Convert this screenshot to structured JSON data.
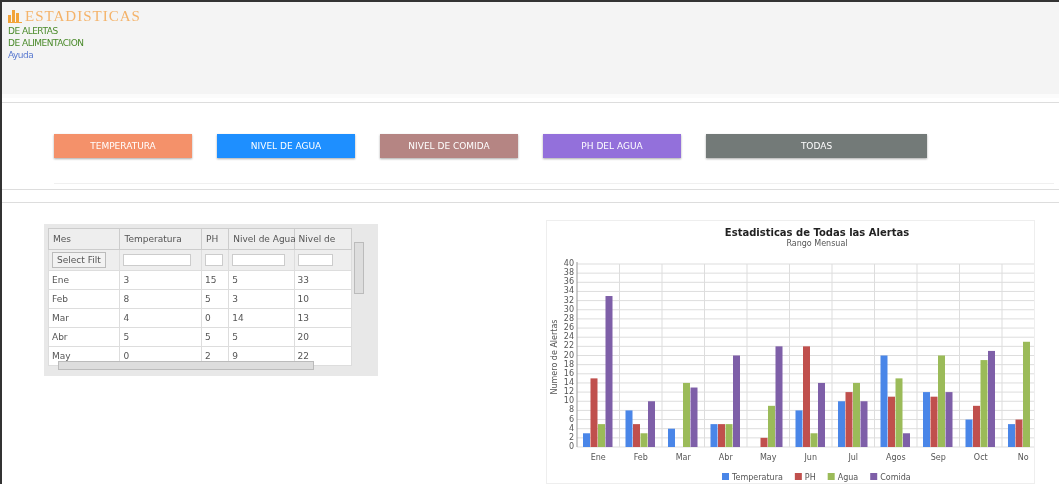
{
  "header": {
    "title": "ESTADISTICAS",
    "links": [
      {
        "label": "DE ALERTAS",
        "kind": "nav"
      },
      {
        "label": "DE ALIMENTACION",
        "kind": "nav"
      },
      {
        "label": "Ayuda",
        "kind": "help"
      }
    ]
  },
  "filters": [
    {
      "label": "TEMPERATURA",
      "color": "#f4916a"
    },
    {
      "label": "NIVEL DE AGUA",
      "color": "#1e8fff"
    },
    {
      "label": "NIVEL DE COMIDA",
      "color": "#b58583"
    },
    {
      "label": "PH DEL AGUA",
      "color": "#9370db"
    },
    {
      "label": "TODAS",
      "color": "#737a78"
    }
  ],
  "table": {
    "columns": [
      "Mes",
      "Temperatura",
      "PH",
      "Nivel de Agua",
      "Nivel de"
    ],
    "filter_button": "Select Filt",
    "rows": [
      [
        "Ene",
        "3",
        "15",
        "5",
        "33"
      ],
      [
        "Feb",
        "8",
        "5",
        "3",
        "10"
      ],
      [
        "Mar",
        "4",
        "0",
        "14",
        "13"
      ],
      [
        "Abr",
        "5",
        "5",
        "5",
        "20"
      ],
      [
        "May",
        "0",
        "2",
        "9",
        "22"
      ]
    ]
  },
  "chart": {
    "chart_data": {
      "type": "bar",
      "title": "Estadisticas de Todas las Alertas",
      "subtitle": "Rango Mensual",
      "ylabel": "Numero de Alertas",
      "categories": [
        "Ene",
        "Feb",
        "Mar",
        "Abr",
        "May",
        "Jun",
        "Jul",
        "Agos",
        "Sep",
        "Oct",
        "No"
      ],
      "grid": true,
      "legend": true,
      "ylim": [
        0,
        40
      ],
      "yticks": [
        0,
        2,
        4,
        6,
        8,
        10,
        12,
        14,
        16,
        18,
        20,
        22,
        24,
        26,
        28,
        30,
        32,
        34,
        36,
        38,
        40
      ],
      "series": [
        {
          "name": "Temperatura",
          "color": "#4a86e8",
          "values": [
            3,
            8,
            4,
            5,
            0,
            8,
            10,
            20,
            12,
            6,
            5
          ]
        },
        {
          "name": "PH",
          "color": "#c0504d",
          "values": [
            15,
            5,
            0,
            5,
            2,
            22,
            12,
            11,
            11,
            9,
            6
          ]
        },
        {
          "name": "Agua",
          "color": "#9bbb59",
          "values": [
            5,
            3,
            14,
            5,
            9,
            3,
            14,
            15,
            20,
            19,
            23
          ]
        },
        {
          "name": "Comida",
          "color": "#7e5fa8",
          "values": [
            33,
            10,
            13,
            20,
            22,
            14,
            10,
            3,
            12,
            21,
            null
          ]
        }
      ]
    }
  }
}
